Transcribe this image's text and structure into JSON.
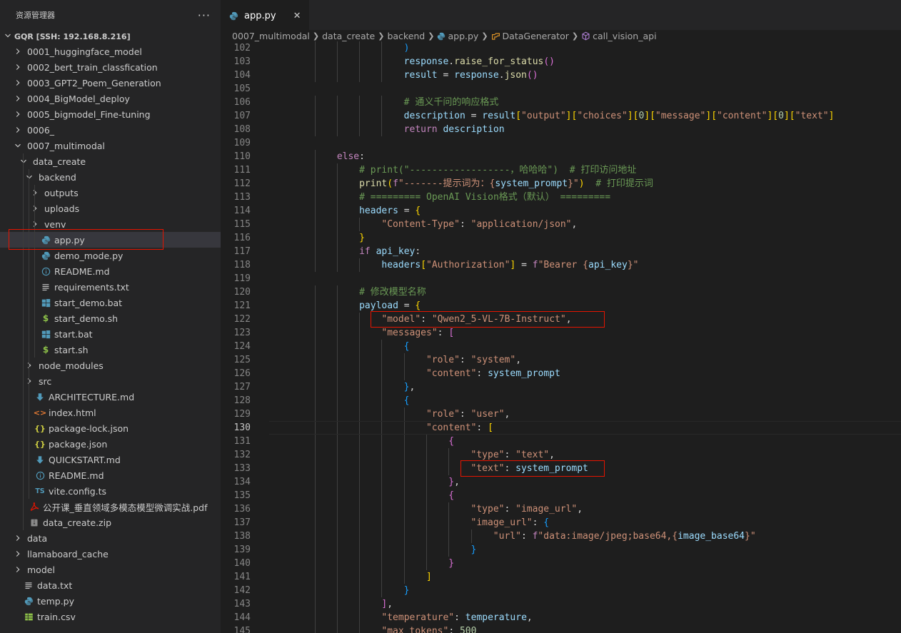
{
  "explorer": {
    "title": "资源管理器",
    "more": "···",
    "root": "GQR [SSH: 192.168.8.216]",
    "items": [
      {
        "label": "0001_huggingface_model",
        "type": "folder",
        "depth": 1,
        "expanded": false
      },
      {
        "label": "0002_bert_train_classfication",
        "type": "folder",
        "depth": 1,
        "expanded": false
      },
      {
        "label": "0003_GPT2_Poem_Generation",
        "type": "folder",
        "depth": 1,
        "expanded": false
      },
      {
        "label": "0004_BigModel_deploy",
        "type": "folder",
        "depth": 1,
        "expanded": false
      },
      {
        "label": "0005_bigmodel_Fine-tuning",
        "type": "folder",
        "depth": 1,
        "expanded": false
      },
      {
        "label": "0006_",
        "type": "folder",
        "depth": 1,
        "expanded": false
      },
      {
        "label": "0007_multimodal",
        "type": "folder",
        "depth": 1,
        "expanded": true
      },
      {
        "label": "data_create",
        "type": "folder",
        "depth": 2,
        "expanded": true
      },
      {
        "label": "backend",
        "type": "folder",
        "depth": 3,
        "expanded": true
      },
      {
        "label": "outputs",
        "type": "folder",
        "depth": 4,
        "expanded": false
      },
      {
        "label": "uploads",
        "type": "folder",
        "depth": 4,
        "expanded": false
      },
      {
        "label": "venv",
        "type": "folder",
        "depth": 4,
        "expanded": false
      },
      {
        "label": "app.py",
        "type": "python",
        "depth": 4,
        "selected": true
      },
      {
        "label": "demo_mode.py",
        "type": "python",
        "depth": 4
      },
      {
        "label": "README.md",
        "type": "info",
        "depth": 4
      },
      {
        "label": "requirements.txt",
        "type": "text",
        "depth": 4
      },
      {
        "label": "start_demo.bat",
        "type": "windows",
        "depth": 4
      },
      {
        "label": "start_demo.sh",
        "type": "shell",
        "depth": 4
      },
      {
        "label": "start.bat",
        "type": "windows",
        "depth": 4
      },
      {
        "label": "start.sh",
        "type": "shell",
        "depth": 4
      },
      {
        "label": "node_modules",
        "type": "folder",
        "depth": 3,
        "expanded": false
      },
      {
        "label": "src",
        "type": "folder",
        "depth": 3,
        "expanded": false
      },
      {
        "label": "ARCHITECTURE.md",
        "type": "markdown",
        "depth": 3
      },
      {
        "label": "index.html",
        "type": "html",
        "depth": 3
      },
      {
        "label": "package-lock.json",
        "type": "json",
        "depth": 3
      },
      {
        "label": "package.json",
        "type": "json",
        "depth": 3
      },
      {
        "label": "QUICKSTART.md",
        "type": "markdown",
        "depth": 3
      },
      {
        "label": "README.md",
        "type": "info",
        "depth": 3
      },
      {
        "label": "vite.config.ts",
        "type": "ts",
        "depth": 3
      },
      {
        "label": "公开课_垂直领域多模态模型微调实战.pdf",
        "type": "pdf",
        "depth": 2
      },
      {
        "label": "data_create.zip",
        "type": "zip",
        "depth": 2
      },
      {
        "label": "data",
        "type": "folder",
        "depth": 1,
        "expanded": false
      },
      {
        "label": "llamaboard_cache",
        "type": "folder",
        "depth": 1,
        "expanded": false
      },
      {
        "label": "model",
        "type": "folder",
        "depth": 1,
        "expanded": false
      },
      {
        "label": "data.txt",
        "type": "text",
        "depth": 1
      },
      {
        "label": "temp.py",
        "type": "python",
        "depth": 1
      },
      {
        "label": "train.csv",
        "type": "csv",
        "depth": 1
      }
    ]
  },
  "editor": {
    "tab": {
      "label": "app.py",
      "close": "✕"
    },
    "breadcrumb": [
      "0007_multimodal",
      "data_create",
      "backend",
      "app.py",
      "DataGenerator",
      "call_vision_api"
    ],
    "current_line": 130,
    "lines": [
      {
        "n": 102,
        "indent": 6,
        "tokens": [
          [
            "b3",
            ")"
          ]
        ]
      },
      {
        "n": 103,
        "indent": 6,
        "tokens": [
          [
            "var",
            "response"
          ],
          [
            "",
            "."
          ],
          [
            "fn",
            "raise_for_status"
          ],
          [
            "b2",
            "()"
          ]
        ]
      },
      {
        "n": 104,
        "indent": 6,
        "tokens": [
          [
            "var",
            "result"
          ],
          [
            "",
            " = "
          ],
          [
            "var",
            "response"
          ],
          [
            "",
            "."
          ],
          [
            "fn",
            "json"
          ],
          [
            "b2",
            "()"
          ]
        ]
      },
      {
        "n": 105,
        "indent": 0,
        "tokens": []
      },
      {
        "n": 106,
        "indent": 6,
        "tokens": [
          [
            "com",
            "# 通义千问的响应格式"
          ]
        ]
      },
      {
        "n": 107,
        "indent": 6,
        "tokens": [
          [
            "var",
            "description"
          ],
          [
            "",
            " = "
          ],
          [
            "var",
            "result"
          ],
          [
            "b1",
            "["
          ],
          [
            "str",
            "\"output\""
          ],
          [
            "b1",
            "]["
          ],
          [
            "str",
            "\"choices\""
          ],
          [
            "b1",
            "]["
          ],
          [
            "num",
            "0"
          ],
          [
            "b1",
            "]["
          ],
          [
            "str",
            "\"message\""
          ],
          [
            "b1",
            "]["
          ],
          [
            "str",
            "\"content\""
          ],
          [
            "b1",
            "]["
          ],
          [
            "num",
            "0"
          ],
          [
            "b1",
            "]["
          ],
          [
            "str",
            "\"text\""
          ],
          [
            "b1",
            "]"
          ]
        ]
      },
      {
        "n": 108,
        "indent": 6,
        "tokens": [
          [
            "kw",
            "return"
          ],
          [
            "",
            " "
          ],
          [
            "var",
            "description"
          ]
        ]
      },
      {
        "n": 109,
        "indent": 0,
        "tokens": []
      },
      {
        "n": 110,
        "indent": 3,
        "tokens": [
          [
            "kw",
            "else"
          ],
          [
            "",
            ":"
          ]
        ]
      },
      {
        "n": 111,
        "indent": 4,
        "tokens": [
          [
            "com",
            "# print(\"------------------，哈哈哈\")  # 打印访问地址"
          ]
        ]
      },
      {
        "n": 112,
        "indent": 4,
        "tokens": [
          [
            "fn",
            "print"
          ],
          [
            "b1",
            "("
          ],
          [
            "kw",
            "f"
          ],
          [
            "str",
            "\"-------提示词为：{"
          ],
          [
            "var",
            "system_prompt"
          ],
          [
            "str",
            "}\""
          ],
          [
            "b1",
            ")"
          ],
          [
            "",
            "  "
          ],
          [
            "com",
            "# 打印提示词"
          ]
        ]
      },
      {
        "n": 113,
        "indent": 4,
        "tokens": [
          [
            "com",
            "# ========= OpenAI Vision格式（默认） ========="
          ]
        ]
      },
      {
        "n": 114,
        "indent": 4,
        "tokens": [
          [
            "var",
            "headers"
          ],
          [
            "",
            " = "
          ],
          [
            "b1",
            "{"
          ]
        ]
      },
      {
        "n": 115,
        "indent": 5,
        "tokens": [
          [
            "str",
            "\"Content-Type\""
          ],
          [
            "",
            ": "
          ],
          [
            "str",
            "\"application/json\""
          ],
          [
            "",
            ","
          ]
        ]
      },
      {
        "n": 116,
        "indent": 4,
        "tokens": [
          [
            "b1",
            "}"
          ]
        ]
      },
      {
        "n": 117,
        "indent": 4,
        "tokens": [
          [
            "kw",
            "if"
          ],
          [
            "",
            " "
          ],
          [
            "var",
            "api_key"
          ],
          [
            "",
            ":"
          ]
        ]
      },
      {
        "n": 118,
        "indent": 5,
        "tokens": [
          [
            "var",
            "headers"
          ],
          [
            "b1",
            "["
          ],
          [
            "str",
            "\"Authorization\""
          ],
          [
            "b1",
            "]"
          ],
          [
            "",
            " = "
          ],
          [
            "kw",
            "f"
          ],
          [
            "str",
            "\"Bearer {"
          ],
          [
            "var",
            "api_key"
          ],
          [
            "str",
            "}\""
          ]
        ]
      },
      {
        "n": 119,
        "indent": 0,
        "tokens": []
      },
      {
        "n": 120,
        "indent": 4,
        "tokens": [
          [
            "com",
            "# 修改模型名称"
          ]
        ]
      },
      {
        "n": 121,
        "indent": 4,
        "tokens": [
          [
            "var",
            "payload"
          ],
          [
            "",
            " = "
          ],
          [
            "b1",
            "{"
          ]
        ]
      },
      {
        "n": 122,
        "indent": 5,
        "tokens": [
          [
            "str",
            "\"model\""
          ],
          [
            "",
            ": "
          ],
          [
            "str",
            "\"Qwen2_5-VL-7B-Instruct\""
          ],
          [
            "",
            ","
          ]
        ]
      },
      {
        "n": 123,
        "indent": 5,
        "tokens": [
          [
            "str",
            "\"messages\""
          ],
          [
            "",
            ": "
          ],
          [
            "b2",
            "["
          ]
        ]
      },
      {
        "n": 124,
        "indent": 6,
        "tokens": [
          [
            "b3",
            "{"
          ]
        ]
      },
      {
        "n": 125,
        "indent": 7,
        "tokens": [
          [
            "str",
            "\"role\""
          ],
          [
            "",
            ": "
          ],
          [
            "str",
            "\"system\""
          ],
          [
            "",
            ","
          ]
        ]
      },
      {
        "n": 126,
        "indent": 7,
        "tokens": [
          [
            "str",
            "\"content\""
          ],
          [
            "",
            ": "
          ],
          [
            "var",
            "system_prompt"
          ]
        ]
      },
      {
        "n": 127,
        "indent": 6,
        "tokens": [
          [
            "b3",
            "}"
          ],
          [
            "",
            ","
          ]
        ]
      },
      {
        "n": 128,
        "indent": 6,
        "tokens": [
          [
            "b3",
            "{"
          ]
        ]
      },
      {
        "n": 129,
        "indent": 7,
        "tokens": [
          [
            "str",
            "\"role\""
          ],
          [
            "",
            ": "
          ],
          [
            "str",
            "\"user\""
          ],
          [
            "",
            ","
          ]
        ]
      },
      {
        "n": 130,
        "indent": 7,
        "tokens": [
          [
            "str",
            "\"content\""
          ],
          [
            "",
            ": "
          ],
          [
            "b1",
            "["
          ]
        ]
      },
      {
        "n": 131,
        "indent": 8,
        "tokens": [
          [
            "b2",
            "{"
          ]
        ]
      },
      {
        "n": 132,
        "indent": 9,
        "tokens": [
          [
            "str",
            "\"type\""
          ],
          [
            "",
            ": "
          ],
          [
            "str",
            "\"text\""
          ],
          [
            "",
            ","
          ]
        ]
      },
      {
        "n": 133,
        "indent": 9,
        "tokens": [
          [
            "str",
            "\"text\""
          ],
          [
            "",
            ": "
          ],
          [
            "var",
            "system_prompt"
          ]
        ]
      },
      {
        "n": 134,
        "indent": 8,
        "tokens": [
          [
            "b2",
            "}"
          ],
          [
            "",
            ","
          ]
        ]
      },
      {
        "n": 135,
        "indent": 8,
        "tokens": [
          [
            "b2",
            "{"
          ]
        ]
      },
      {
        "n": 136,
        "indent": 9,
        "tokens": [
          [
            "str",
            "\"type\""
          ],
          [
            "",
            ": "
          ],
          [
            "str",
            "\"image_url\""
          ],
          [
            "",
            ","
          ]
        ]
      },
      {
        "n": 137,
        "indent": 9,
        "tokens": [
          [
            "str",
            "\"image_url\""
          ],
          [
            "",
            ": "
          ],
          [
            "b3",
            "{"
          ]
        ]
      },
      {
        "n": 138,
        "indent": 10,
        "tokens": [
          [
            "str",
            "\"url\""
          ],
          [
            "",
            ": "
          ],
          [
            "kw",
            "f"
          ],
          [
            "str",
            "\"data:image/jpeg;base64,{"
          ],
          [
            "var",
            "image_base64"
          ],
          [
            "str",
            "}\""
          ]
        ]
      },
      {
        "n": 139,
        "indent": 9,
        "tokens": [
          [
            "b3",
            "}"
          ]
        ]
      },
      {
        "n": 140,
        "indent": 8,
        "tokens": [
          [
            "b2",
            "}"
          ]
        ]
      },
      {
        "n": 141,
        "indent": 7,
        "tokens": [
          [
            "b1",
            "]"
          ]
        ]
      },
      {
        "n": 142,
        "indent": 6,
        "tokens": [
          [
            "b3",
            "}"
          ]
        ]
      },
      {
        "n": 143,
        "indent": 5,
        "tokens": [
          [
            "b2",
            "]"
          ],
          [
            "",
            ","
          ]
        ]
      },
      {
        "n": 144,
        "indent": 5,
        "tokens": [
          [
            "str",
            "\"temperature\""
          ],
          [
            "",
            ": "
          ],
          [
            "var",
            "temperature"
          ],
          [
            "",
            ","
          ]
        ]
      },
      {
        "n": 145,
        "indent": 5,
        "tokens": [
          [
            "str",
            "\"max_tokens\""
          ],
          [
            "",
            ": "
          ],
          [
            "num",
            "500"
          ]
        ]
      }
    ]
  },
  "colors": {
    "highlight_box": "#e51400",
    "selection": "#37373d",
    "python_icon": "#519aba",
    "folder_chevron": "#c5c5c5"
  }
}
